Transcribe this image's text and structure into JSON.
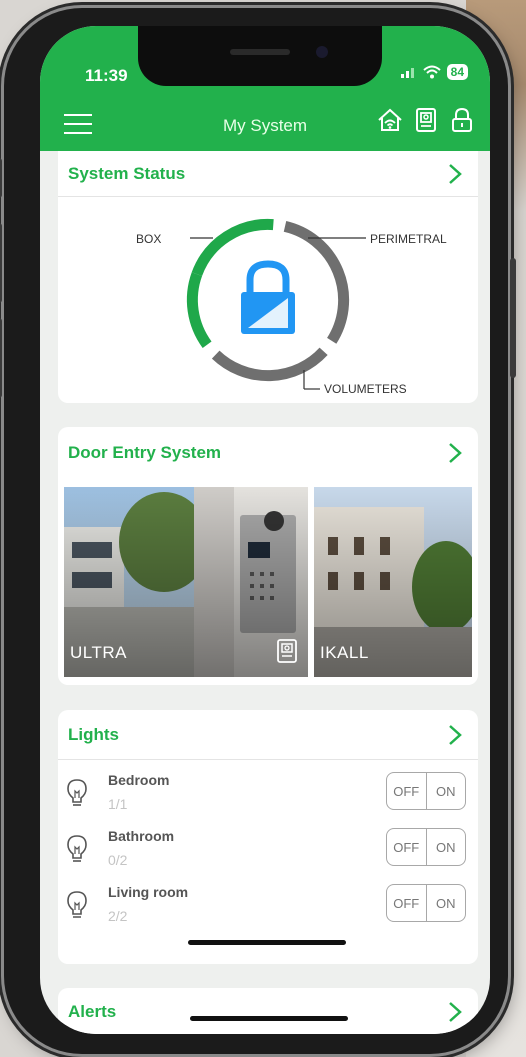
{
  "status_bar": {
    "time": "11:39",
    "battery": "84"
  },
  "header": {
    "title": "My System",
    "icons": [
      "menu-icon",
      "home-wifi-icon",
      "intercom-icon",
      "padlock-icon"
    ]
  },
  "system_status": {
    "title": "System Status",
    "labels": {
      "box": "BOX",
      "perimetral": "PERIMETRAL",
      "volumeters": "VOLUMETERS"
    }
  },
  "door_entry": {
    "title": "Door Entry System",
    "tiles": [
      {
        "label": "ULTRA"
      },
      {
        "label": "IKALL"
      }
    ]
  },
  "lights": {
    "title": "Lights",
    "rooms": [
      {
        "name": "Bedroom",
        "count": "1/1",
        "off": "OFF",
        "on": "ON"
      },
      {
        "name": "Bathroom",
        "count": "0/2",
        "off": "OFF",
        "on": "ON"
      },
      {
        "name": "Living room",
        "count": "2/2",
        "off": "OFF",
        "on": "ON"
      }
    ]
  },
  "alerts": {
    "title": "Alerts"
  },
  "colors": {
    "brand": "#22b14c",
    "active_ring": "#1fa84a",
    "inactive_ring": "#6f6f6f",
    "lock": "#2196f3"
  }
}
